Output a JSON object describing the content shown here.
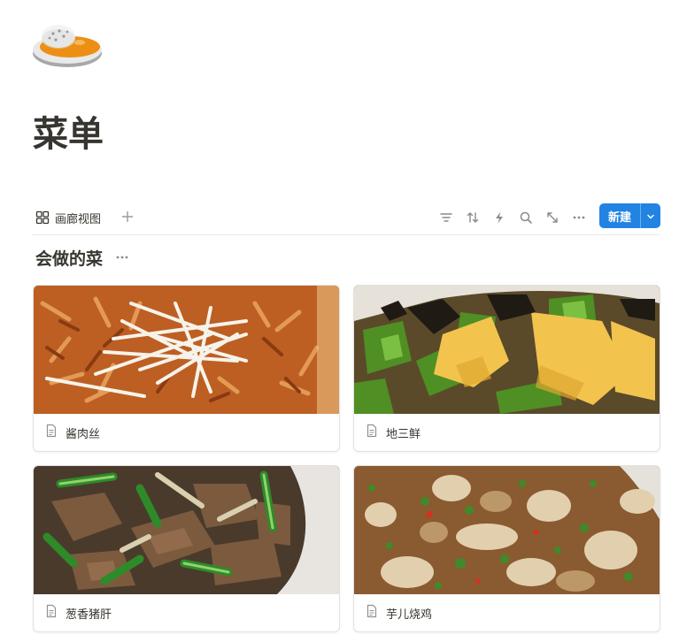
{
  "page": {
    "icon": "rice-curry-plate-icon",
    "title": "菜单"
  },
  "view_bar": {
    "view_name": "画廊视图",
    "view_icon": "gallery-grid-icon",
    "add_view_icon": "plus-icon",
    "toolbar_icons": [
      "filter-icon",
      "sort-icon",
      "automation-bolt-icon",
      "search-icon",
      "expand-icon",
      "more-icon"
    ],
    "new_button_label": "新建",
    "new_dropdown_icon": "chevron-down-icon",
    "accent_color": "#2383e2"
  },
  "group": {
    "title": "会做的菜",
    "more_icon": "more-icon"
  },
  "cards": [
    {
      "title": "酱肉丝",
      "icon": "page-icon",
      "image": "food-photo"
    },
    {
      "title": "地三鲜",
      "icon": "page-icon",
      "image": "food-photo"
    },
    {
      "title": "葱香猪肝",
      "icon": "page-icon",
      "image": "food-photo"
    },
    {
      "title": "芋儿烧鸡",
      "icon": "page-icon",
      "image": "food-photo"
    }
  ]
}
